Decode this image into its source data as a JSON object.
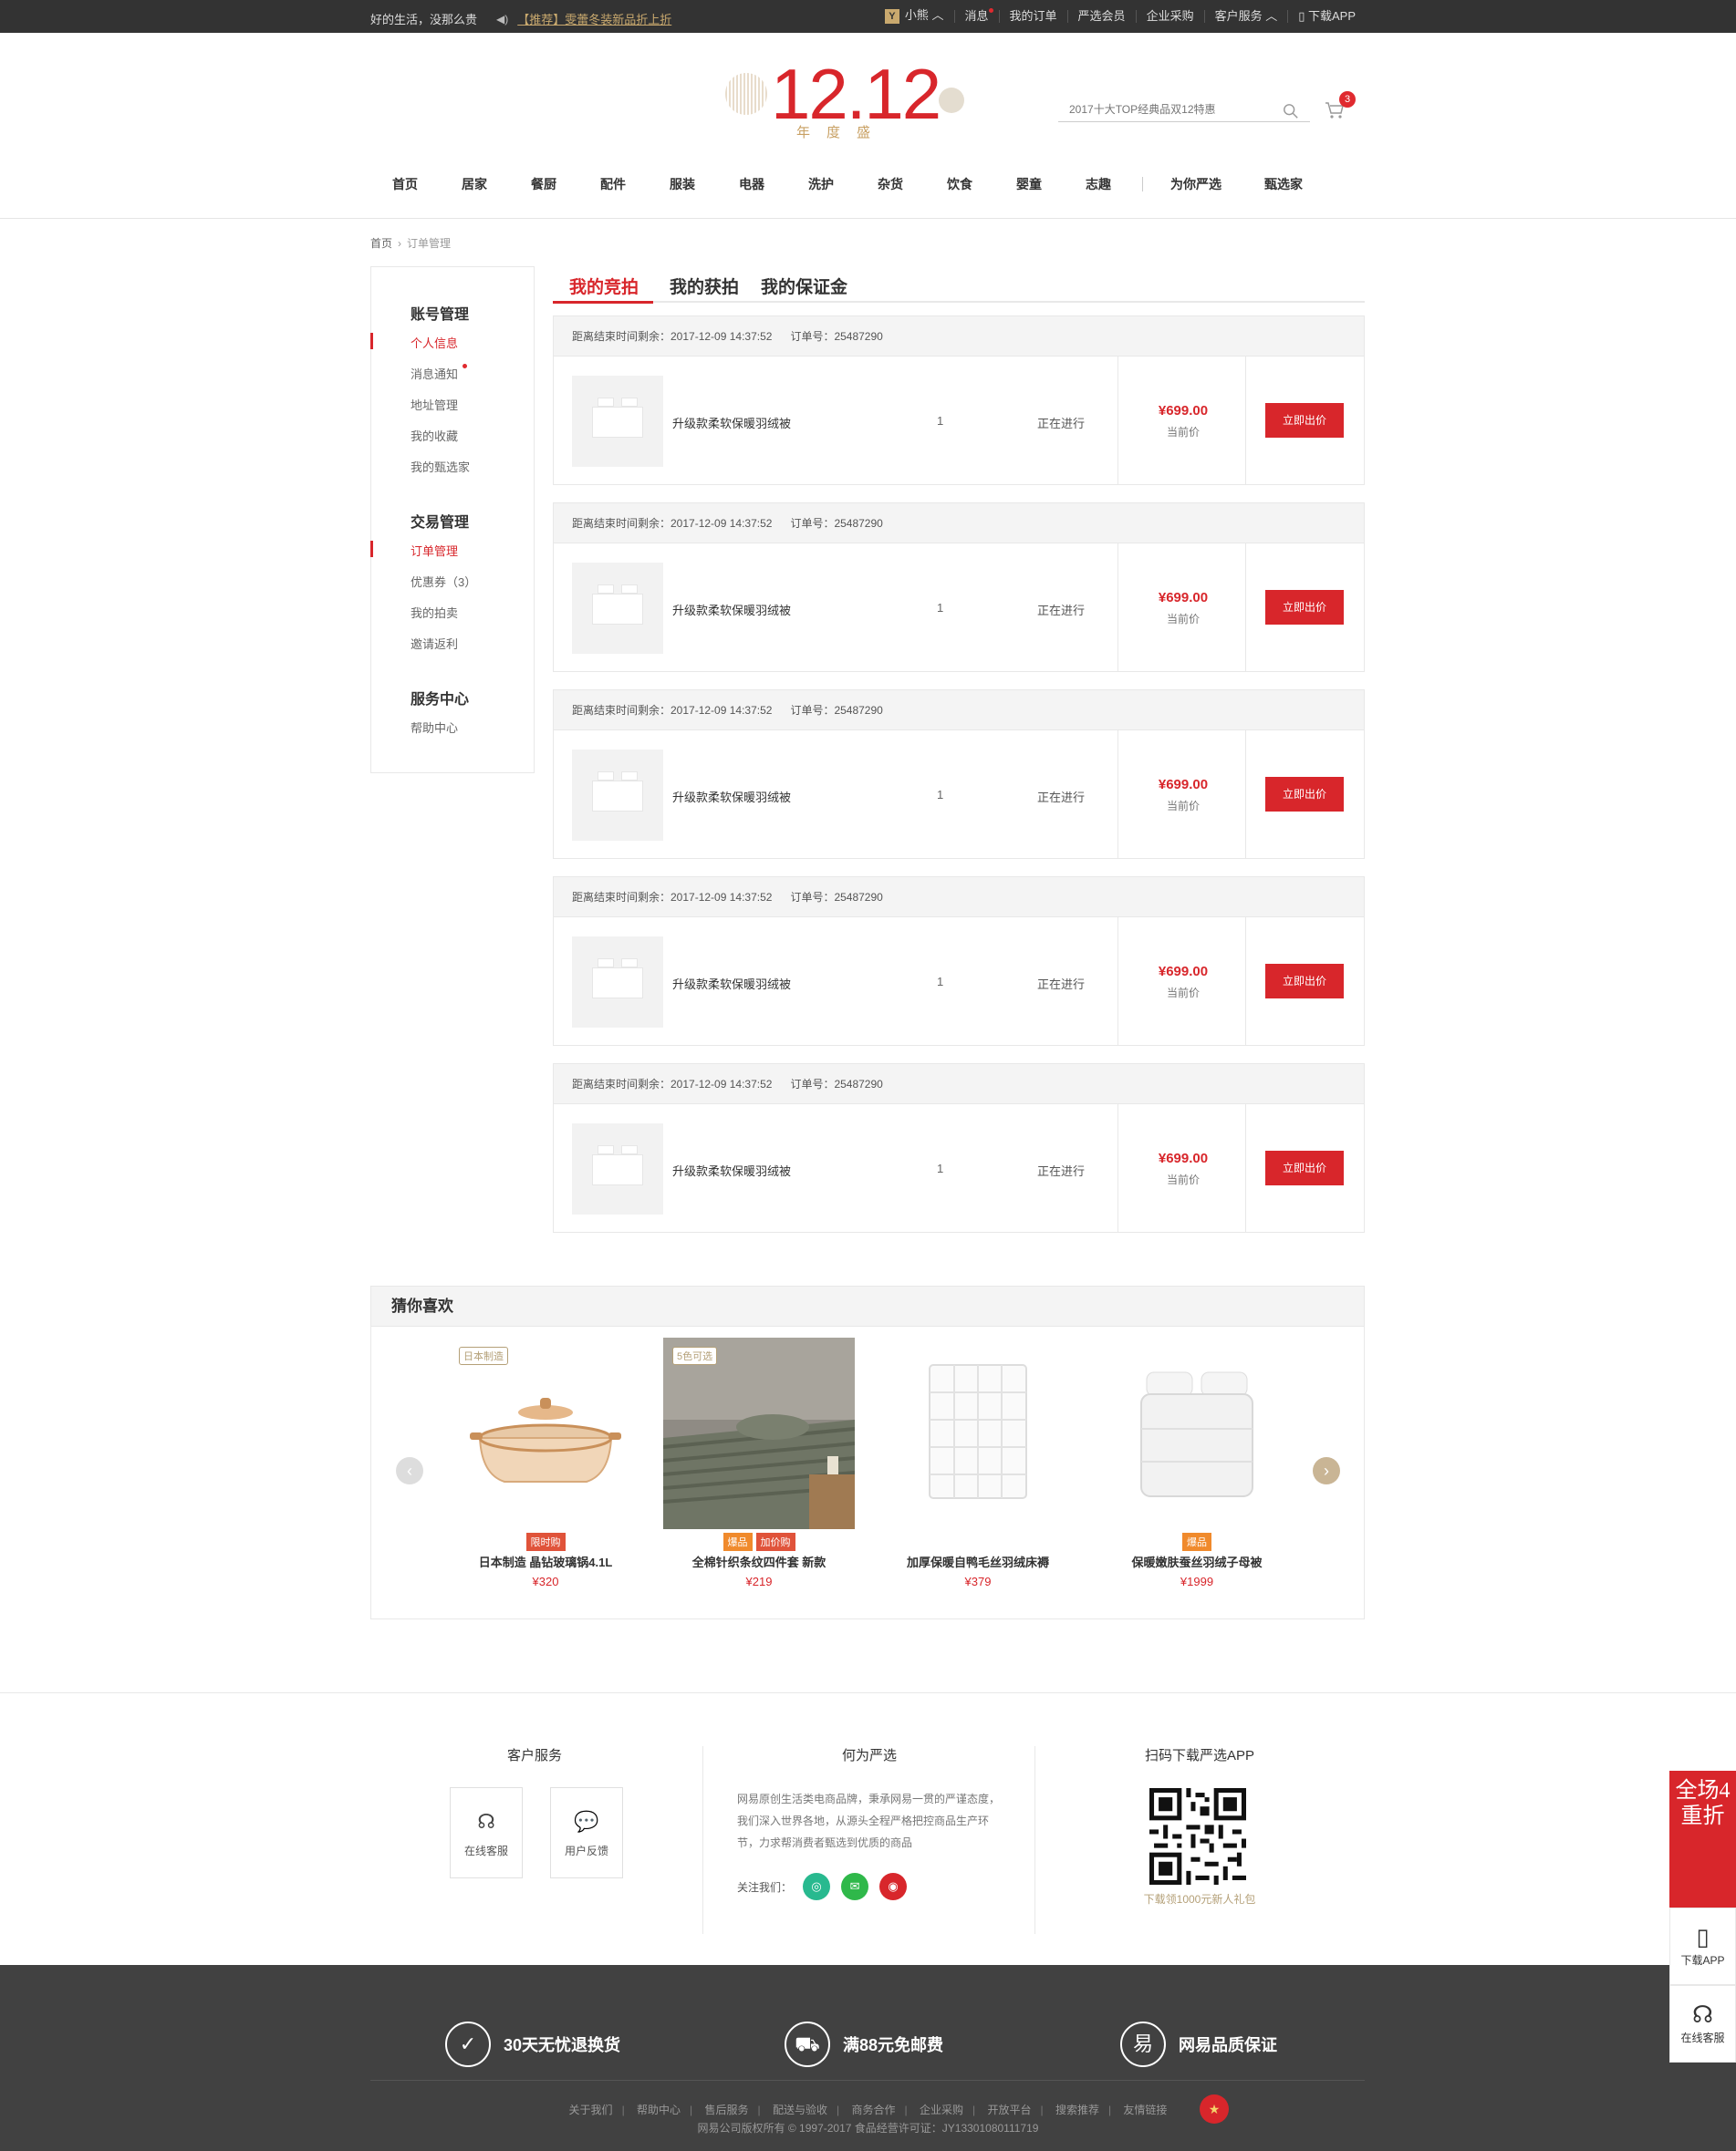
{
  "topbar": {
    "slogan": "好的生活，没那么贵",
    "notice": "【推荐】雯蕾冬装新品折上折",
    "user": "小熊",
    "user_badge": "Y",
    "links": [
      "消息",
      "我的订单",
      "严选会员",
      "企业采购",
      "客户服务",
      "下载APP"
    ]
  },
  "logo": {
    "number": "12.12",
    "subtitle": "年度盛"
  },
  "search": {
    "placeholder": "2017十大TOP经典品双12特惠"
  },
  "cart": {
    "count": "3"
  },
  "nav": [
    "首页",
    "居家",
    "餐厨",
    "配件",
    "服装",
    "电器",
    "洗护",
    "杂货",
    "饮食",
    "婴童",
    "志趣",
    "为你严选",
    "甄选家"
  ],
  "breadcrumb": {
    "home": "首页",
    "current": "订单管理"
  },
  "sidebar": {
    "groups": [
      {
        "title": "账号管理",
        "items": [
          "个人信息",
          "消息通知",
          "地址管理",
          "我的收藏",
          "我的甄选家"
        ]
      },
      {
        "title": "交易管理",
        "items": [
          "订单管理",
          "优惠券（3）",
          "我的拍卖",
          "邀请返利"
        ]
      },
      {
        "title": "服务中心",
        "items": [
          "帮助中心"
        ]
      }
    ]
  },
  "tabs": [
    "我的竞拍",
    "我的获拍",
    "我的保证金"
  ],
  "orders": [
    {
      "countdown": "距离结束时间剩余：2017-12-09 14:37:52",
      "order_no": "订单号：25487290",
      "name": "升级款柔软保暖羽绒被",
      "qty": "1",
      "status": "正在进行",
      "price": "¥699.00",
      "price_label": "当前价",
      "action": "立即出价"
    },
    {
      "countdown": "距离结束时间剩余：2017-12-09 14:37:52",
      "order_no": "订单号：25487290",
      "name": "升级款柔软保暖羽绒被",
      "qty": "1",
      "status": "正在进行",
      "price": "¥699.00",
      "price_label": "当前价",
      "action": "立即出价"
    },
    {
      "countdown": "距离结束时间剩余：2017-12-09 14:37:52",
      "order_no": "订单号：25487290",
      "name": "升级款柔软保暖羽绒被",
      "qty": "1",
      "status": "正在进行",
      "price": "¥699.00",
      "price_label": "当前价",
      "action": "立即出价"
    },
    {
      "countdown": "距离结束时间剩余：2017-12-09 14:37:52",
      "order_no": "订单号：25487290",
      "name": "升级款柔软保暖羽绒被",
      "qty": "1",
      "status": "正在进行",
      "price": "¥699.00",
      "price_label": "当前价",
      "action": "立即出价"
    },
    {
      "countdown": "距离结束时间剩余：2017-12-09 14:37:52",
      "order_no": "订单号：25487290",
      "name": "升级款柔软保暖羽绒被",
      "qty": "1",
      "status": "正在进行",
      "price": "¥699.00",
      "price_label": "当前价",
      "action": "立即出价"
    }
  ],
  "guess": {
    "title": "猜你喜欢",
    "products": [
      {
        "tag": "日本制造",
        "badges": [
          "限时购"
        ],
        "name": "日本制造 晶钻玻璃锅4.1L",
        "price": "¥320"
      },
      {
        "tag": "5色可选",
        "badges": [
          "爆品",
          "加价购"
        ],
        "name": "全棉针织条纹四件套 新款",
        "price": "¥219"
      },
      {
        "tag": "",
        "badges": [],
        "name": "加厚保暖自鸭毛丝羽绒床褥",
        "price": "¥379"
      },
      {
        "tag": "",
        "badges": [
          "爆品"
        ],
        "name": "保暖嫩肤蚕丝羽绒子母被",
        "price": "¥1999"
      }
    ]
  },
  "footer": {
    "service_title": "客户服务",
    "service_items": [
      "在线客服",
      "用户反馈"
    ],
    "about_title": "何为严选",
    "about_text": "网易原创生活类电商品牌，秉承网易一贯的严谨态度，我们深入世界各地，从源头全程严格把控商品生产环节，力求帮消费者甄选到优质的商品",
    "follow_label": "关注我们：",
    "app_title": "扫码下载严选APP",
    "app_tip": "下载领1000元新人礼包",
    "promises": [
      "30天无忧退换货",
      "满88元免邮费",
      "网易品质保证"
    ],
    "links": [
      "关于我们",
      "帮助中心",
      "售后服务",
      "配送与验收",
      "商务合作",
      "企业采购",
      "开放平台",
      "搜索推荐",
      "友情链接"
    ],
    "copyright": "网易公司版权所有 © 1997-2017   食品经营许可证：JY13301080111719"
  },
  "float": {
    "sale": "全场4重折",
    "download": "下载APP",
    "service": "在线客服"
  }
}
